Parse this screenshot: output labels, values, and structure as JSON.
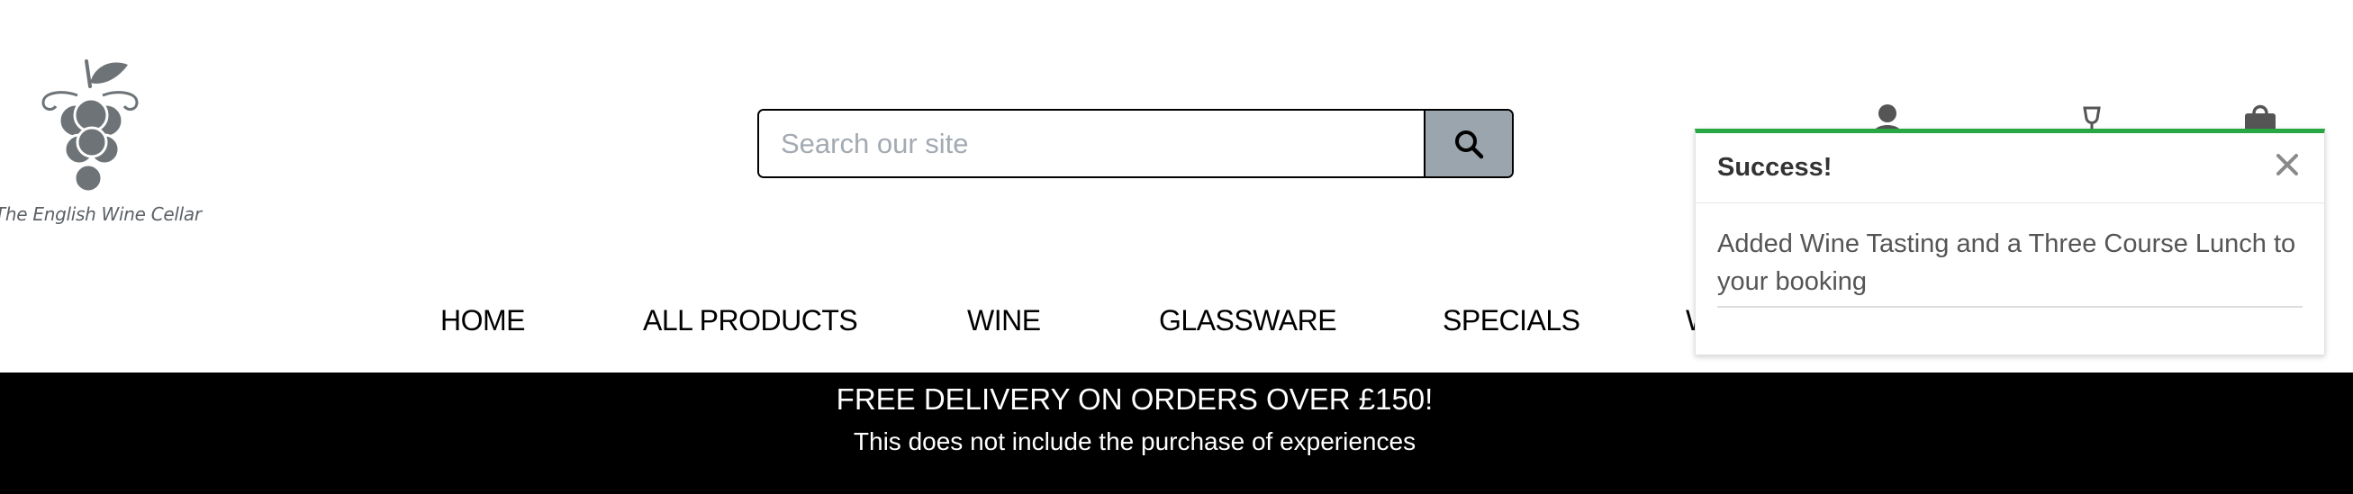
{
  "brand": {
    "name": "The English Wine Cellar",
    "logo_icon": "grape-bunch-icon",
    "color": "#6d7377"
  },
  "search": {
    "placeholder": "Search our site",
    "button_icon": "search-icon",
    "button_color": "#9aa5ad"
  },
  "header_icons": [
    "account-icon",
    "wine-glass-icon",
    "basket-icon"
  ],
  "nav": {
    "items": [
      "HOME",
      "ALL PRODUCTS",
      "WINE",
      "GLASSWARE",
      "SPECIALS",
      "W"
    ]
  },
  "promo": {
    "title": "FREE DELIVERY ON ORDERS OVER £150!",
    "subtitle": "This does not include the purchase of experiences"
  },
  "toast": {
    "title": "Success!",
    "message": "Added Wine Tasting and a Three Course Lunch to your booking",
    "accent_color": "#28a745",
    "close_icon": "close-icon"
  }
}
